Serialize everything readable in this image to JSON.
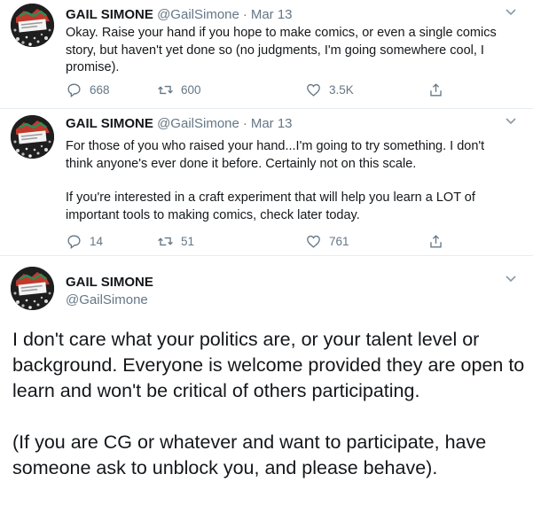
{
  "tweets": [
    {
      "name": "GAIL SIMONE",
      "handle": "@GailSimone",
      "date": "Mar 13",
      "text": "Okay. Raise your hand if you hope to make comics, or even a single comics story, but haven't yet done so (no judgments, I'm going somewhere cool, I promise).",
      "replies": "668",
      "retweets": "600",
      "likes": "3.5K"
    },
    {
      "name": "GAIL SIMONE",
      "handle": "@GailSimone",
      "date": "Mar 13",
      "paragraphs": [
        "For those of you who raised your hand...I'm going to try something. I don't think anyone's ever done it before. Certainly not on this scale.",
        "If you're interested in a craft experiment that will help you learn a LOT of important tools to making comics, check later today."
      ],
      "replies": "14",
      "retweets": "51",
      "likes": "761"
    },
    {
      "name": "GAIL SIMONE",
      "handle": "@GailSimone",
      "paragraphs": [
        "I don't care what your politics are, or your talent level or background. Everyone is welcome provided they are open to learn and won't be critical of others participating.",
        "(If you are CG or whatever and want to participate, have someone ask to unblock you, and please behave)."
      ]
    }
  ],
  "icons": [
    "reply-icon",
    "retweet-icon",
    "like-icon",
    "share-icon",
    "chevron-down-icon"
  ],
  "colors": {
    "secondary_text": "#657786",
    "border": "#e6ecf0",
    "text": "#14171a"
  }
}
